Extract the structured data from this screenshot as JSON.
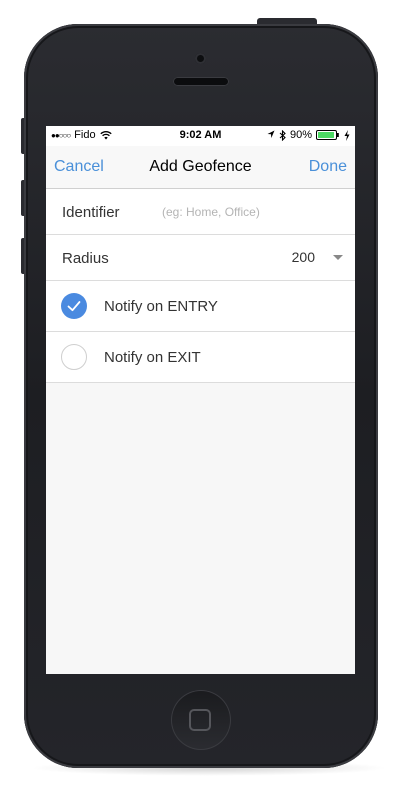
{
  "status_bar": {
    "carrier": "Fido",
    "signal_dots": "●●○○○",
    "time": "9:02 AM",
    "battery_percent": "90%",
    "icons": [
      "wifi-icon",
      "location-arrow-icon",
      "bluetooth-icon",
      "battery-icon",
      "charging-bolt-icon"
    ]
  },
  "nav": {
    "cancel_label": "Cancel",
    "title": "Add Geofence",
    "done_label": "Done"
  },
  "form": {
    "identifier_label": "Identifier",
    "identifier_value": "",
    "identifier_placeholder": "(eg: Home, Office)",
    "radius_label": "Radius",
    "radius_value": "200",
    "notify_entry_label": "Notify on ENTRY",
    "notify_entry_checked": true,
    "notify_exit_label": "Notify on EXIT",
    "notify_exit_checked": false
  },
  "colors": {
    "accent": "#4a90d9",
    "checked_fill": "#4a8ae0",
    "battery_green": "#4cd964",
    "phone_body": "#1d1e22"
  }
}
